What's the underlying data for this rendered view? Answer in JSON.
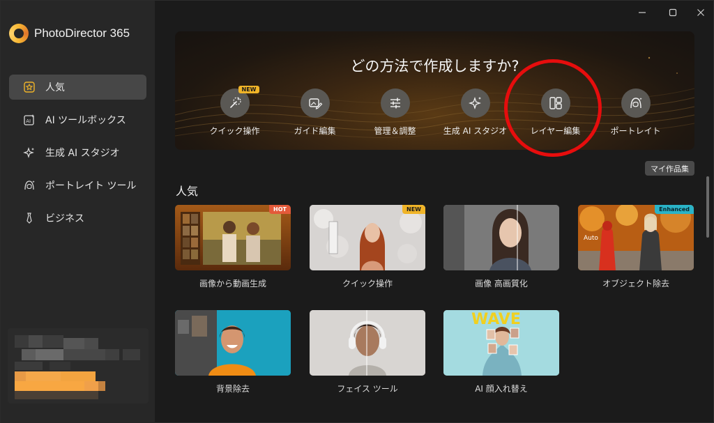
{
  "app": {
    "title": "PhotoDirector 365"
  },
  "sidebar": {
    "items": [
      {
        "label": "人気",
        "icon": "star-icon",
        "active": true
      },
      {
        "label": "AI ツールボックス",
        "icon": "ai-toolbox-icon",
        "active": false
      },
      {
        "label": "生成 AI スタジオ",
        "icon": "sparkle-icon",
        "active": false
      },
      {
        "label": "ポートレイト ツール",
        "icon": "portrait-icon",
        "active": false
      },
      {
        "label": "ビジネス",
        "icon": "tie-icon",
        "active": false
      }
    ]
  },
  "hero": {
    "title": "どの方法で作成しますか?",
    "options": [
      {
        "label": "クイック操作",
        "icon": "magic-wand-icon",
        "badge": "NEW"
      },
      {
        "label": "ガイド編集",
        "icon": "image-edit-icon"
      },
      {
        "label": "管理＆調整",
        "icon": "sliders-icon"
      },
      {
        "label": "生成 AI スタジオ",
        "icon": "sparkle-icon"
      },
      {
        "label": "レイヤー編集",
        "icon": "layers-icon",
        "highlighted": true
      },
      {
        "label": "ポートレイト",
        "icon": "portrait-icon"
      }
    ]
  },
  "my_works_label": "マイ作品集",
  "section": {
    "title": "人気",
    "cards": [
      {
        "label": "画像から動画生成",
        "tag": "HOT"
      },
      {
        "label": "クイック操作",
        "tag": "NEW"
      },
      {
        "label": "画像 高画質化",
        "tag": ""
      },
      {
        "label": "オブジェクト除去",
        "tag": "Enhanced"
      },
      {
        "label": "背景除去",
        "tag": ""
      },
      {
        "label": "フェイス ツール",
        "tag": ""
      },
      {
        "label": "AI 顔入れ替え",
        "tag": ""
      }
    ],
    "extra_text": {
      "auto": "Auto",
      "wave": "WAVE"
    }
  },
  "colors": {
    "accent": "#f0b428",
    "hot": "#e35a3a",
    "enhanced": "#2ab3c7",
    "highlight_ring": "#e60d0d"
  }
}
